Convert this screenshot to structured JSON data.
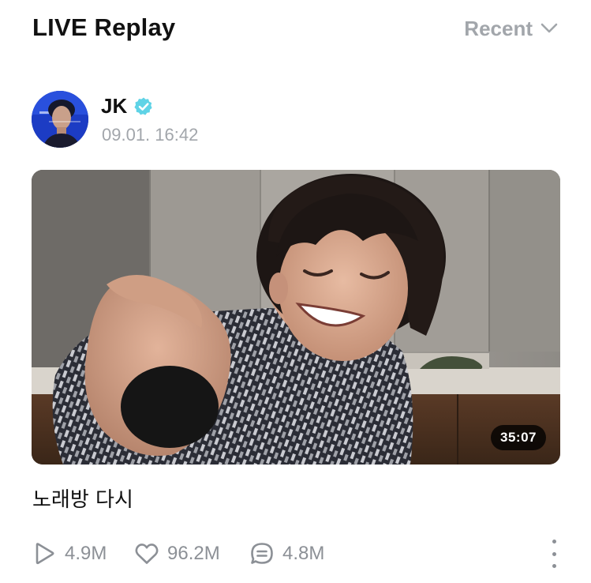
{
  "header": {
    "title": "LIVE Replay",
    "sort_label": "Recent",
    "sort_icon": "chevron-down-icon"
  },
  "post": {
    "author": {
      "name": "JK",
      "verified": true,
      "verified_color": "#5fd3e6"
    },
    "timestamp": "09.01. 16:42",
    "video": {
      "duration": "35:07"
    },
    "title": "노래방 다시",
    "stats": {
      "plays": "4.9M",
      "likes": "96.2M",
      "comments": "4.8M"
    }
  },
  "colors": {
    "text_primary": "#111111",
    "text_secondary": "#a2a6ab",
    "stat_gray": "#8c9096",
    "badge_bg": "#000000"
  }
}
